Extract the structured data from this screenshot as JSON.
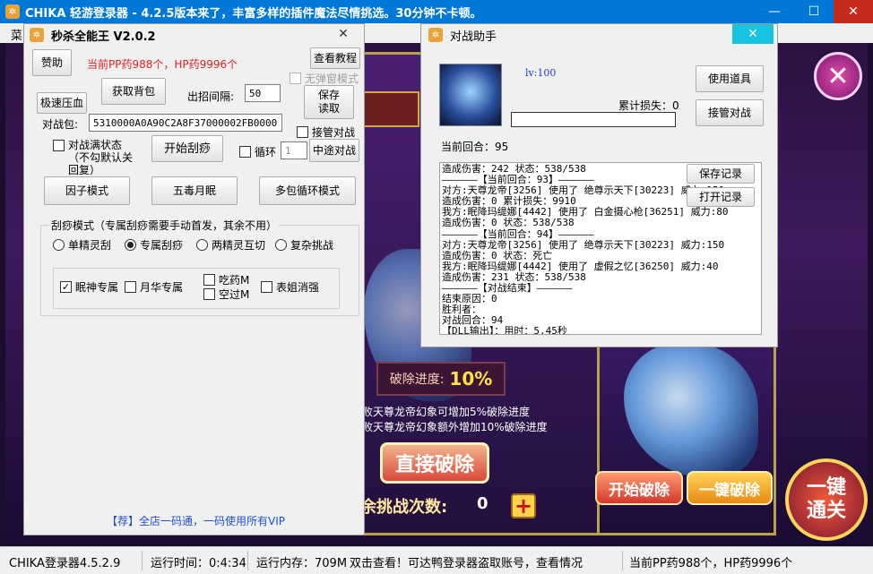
{
  "main_window": {
    "title": "CHIKA 轻游登录器  -  4.2.5版本来了，丰富多样的插件魔法尽情挑选。30分钟不卡顿。",
    "menu_label": "菜"
  },
  "game": {
    "progress_label": "破除进度:",
    "progress_value": "10%",
    "progress_fraction": 0.1,
    "line1": "败天尊龙帝幻象可增加5%破除进度",
    "line2": "击败天尊龙帝幻象额外增加10%破除进度",
    "direct_break": "直接破除",
    "start_break": "开始破除",
    "onekey_break": "一键破除",
    "onekey_pass": "一键\n通关",
    "challenge_label": "余挑战次数:",
    "challenge_count": "0",
    "close_glyph": "✕",
    "plus_glyph": "+"
  },
  "tool": {
    "title": "秒杀全能王 V2.0.2",
    "sponsor": "赞助",
    "pp_hp_info": "当前PP药988个，HP药9996个",
    "view_tutorial": "查看教程",
    "no_popup": "无弹窗模式",
    "fast_blood": "极速压血",
    "get_bag": "获取背包",
    "interval_label": "出招间隔:",
    "interval_value": "50",
    "save_read": "保存\n读取",
    "packet_label": "对战包:",
    "packet_value": "5310000A0A90C2A8F37000002FB000036E2",
    "auto_battle": "接管对战",
    "full_state": "对战满状态（不勾默认关回复）",
    "start_scrape": "开始刮痧",
    "loop": "循环",
    "loop_value": "1",
    "midway_battle": "中途对战",
    "factor_mode": "因子模式",
    "five_poison": "五毒月眠",
    "multi_loop": "多包循环模式",
    "scrape_group_title": "刮痧模式（专属刮痧需要手动首发，其余不用）",
    "radios": [
      {
        "label": "单精灵刮",
        "checked": false
      },
      {
        "label": "专属刮痧",
        "checked": true
      },
      {
        "label": "两精灵互切",
        "checked": false
      },
      {
        "label": "复杂挑战",
        "checked": false
      }
    ],
    "checks": {
      "mianshen": {
        "label": "眠神专属",
        "checked": true
      },
      "yuehua": {
        "label": "月华专属",
        "checked": false
      },
      "eat_medicine": {
        "label": "吃药M",
        "checked": false
      },
      "empty_m": {
        "label": "空过M",
        "checked": false
      },
      "biaojie": {
        "label": "表姐消强",
        "checked": false
      }
    },
    "footer": "【荐】全店一码通，一码使用所有VIP"
  },
  "battle": {
    "title": "对战助手",
    "level": "lv:100",
    "cumulative_loss": "累计损失：0",
    "current_round": "当前回合：95",
    "use_item": "使用道具",
    "take_over": "接管对战",
    "save_log": "保存记录",
    "open_log": "打开记录",
    "log_lines": [
      "造成伤害：242 状态：538/538",
      "——————【当前回合：93】——————",
      "对方:天尊龙帝[3256] 使用了 绝尊示天下[30223] 威力:150",
      "造成伤害：0 累计损失：9910",
      "我方:眠降玛缇娜[4442] 使用了 白金摄心枪[36251] 威力:80",
      "造成伤害：0 状态：538/538",
      "——————【当前回合：94】——————",
      "对方:天尊龙帝[3256] 使用了 绝尊示天下[30223] 威力:150",
      "造成伤害：0 状态：死亡",
      "我方:眠降玛缇娜[4442] 使用了 虚假之忆[36250] 威力:40",
      "造成伤害：231 状态：538/538",
      "——————【对战结束】——————",
      "结束原因：0",
      "胜利者：",
      "对战回合：94",
      "【DLL输出】：用时：5.45秒"
    ]
  },
  "statusbar": {
    "app_version": "CHIKA登录器4.5.2.9",
    "run_time": "运行时间：0:4:34",
    "run_memory": "运行内存：709M",
    "notice": "双击查看！可达鸭登录器盗取账号，查看情况",
    "pp_hp": "当前PP药988个，HP药9996个"
  }
}
